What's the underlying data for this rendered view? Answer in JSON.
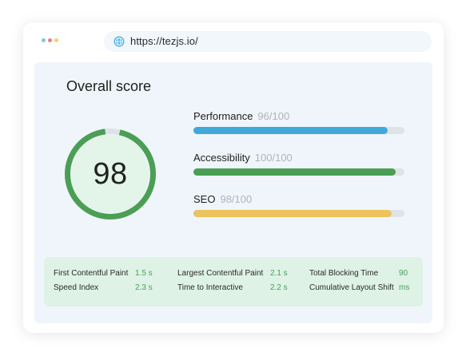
{
  "browser": {
    "url": "https://tezjs.io/"
  },
  "report": {
    "overall_label": "Overall score",
    "overall_score": 98,
    "overall_score_text": "98",
    "metrics": [
      {
        "label": "Performance",
        "score_text": "96/100",
        "value": 96,
        "color": "#3fa9dc"
      },
      {
        "label": "Accessibility",
        "score_text": "100/100",
        "value": 100,
        "color": "#4a9f55"
      },
      {
        "label": "SEO",
        "score_text": "98/100",
        "value": 98,
        "color": "#ecc35c"
      }
    ],
    "stats": [
      {
        "label": "First Contentful Paint",
        "value": "1.5 s"
      },
      {
        "label": "Largest Contentful Paint",
        "value": "2.1 s"
      },
      {
        "label": "Total Blocking Time",
        "value": "90"
      },
      {
        "label": "Speed Index",
        "value": "2.3 s"
      },
      {
        "label": "Time to Interactive",
        "value": "2.2 s"
      },
      {
        "label": "Cumulative Layout Shift",
        "value": "ms"
      }
    ]
  },
  "colors": {
    "gauge": "#4a9f55",
    "gauge_inner": "#e3f4e8",
    "stat_value": "#4aa05a"
  }
}
